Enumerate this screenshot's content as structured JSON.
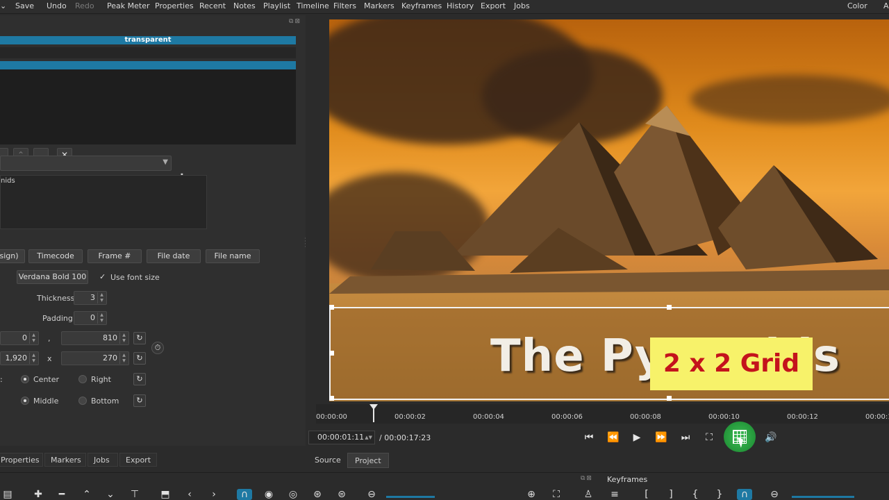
{
  "menu": [
    {
      "label": "Save",
      "enabled": true
    },
    {
      "label": "Undo",
      "enabled": true
    },
    {
      "label": "Redo",
      "enabled": false
    },
    {
      "label": "Peak Meter",
      "enabled": true
    },
    {
      "label": "Properties",
      "enabled": true
    },
    {
      "label": "Recent",
      "enabled": true
    },
    {
      "label": "Notes",
      "enabled": true
    },
    {
      "label": "Playlist",
      "enabled": true
    },
    {
      "label": "Timeline",
      "enabled": true
    },
    {
      "label": "Filters",
      "enabled": true
    },
    {
      "label": "Markers",
      "enabled": true
    },
    {
      "label": "Keyframes",
      "enabled": true
    },
    {
      "label": "History",
      "enabled": true
    },
    {
      "label": "Export",
      "enabled": true
    },
    {
      "label": "Jobs",
      "enabled": true
    }
  ],
  "menu_right": {
    "color": "Color",
    "cut": "A"
  },
  "filters_panel": {
    "selected_filter": "transparent",
    "text_value": "nids",
    "insert_buttons": [
      "sign)",
      "Timecode",
      "Frame #",
      "File date",
      "File name"
    ],
    "font_button": "Verdana Bold 100",
    "use_font_size_label": "Use font size",
    "use_font_size_checked": "✓",
    "thickness_label": "Thickness",
    "thickness_value": "3",
    "padding_label": "Padding",
    "padding_value": "0",
    "position_x": "0",
    "position_sep": ",",
    "position_y": "810",
    "size_w": "1,920",
    "size_sep": "x",
    "size_h": "270",
    "h_align": {
      "center": "Center",
      "right": "Right"
    },
    "v_align": {
      "middle": "Middle",
      "bottom": "Bottom"
    }
  },
  "left_tabs": [
    "Properties",
    "Markers",
    "Jobs",
    "Export"
  ],
  "viewer": {
    "title_text": "The Pyramids",
    "callout_text": "2 x 2 Grid"
  },
  "ruler_ticks": [
    "00:00:00",
    "00:00:02",
    "00:00:04",
    "00:00:06",
    "00:00:08",
    "00:00:10",
    "00:00:12",
    "00:00:1"
  ],
  "transport": {
    "current_time": "00:00:01:11",
    "total_time": "/ 00:00:17:23"
  },
  "source_tabs": {
    "source": "Source",
    "project": "Project"
  },
  "keyframes_title": "Keyframes",
  "icons": {
    "skip_start": "⏮",
    "rewind": "⏪",
    "play": "▶",
    "fast_forward": "⏩",
    "skip_end": "⏭",
    "zoom_fit": "⛶",
    "volume": "🔊",
    "reset": "↻",
    "timer": "⏱",
    "add": "✚",
    "remove": "━",
    "close": "✕",
    "up": "⌃",
    "down": "⌄"
  }
}
